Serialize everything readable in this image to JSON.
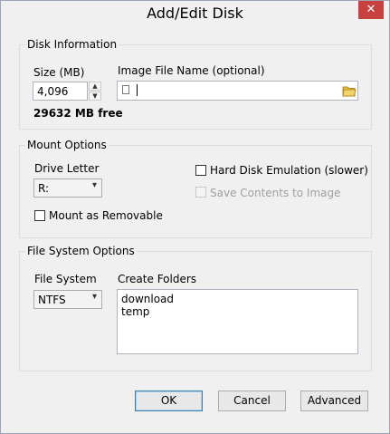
{
  "window": {
    "title": "Add/Edit Disk",
    "close_symbol": "✕"
  },
  "disk_info": {
    "group_label": "Disk Information",
    "size_label": "Size (MB)",
    "size_value": "4,096",
    "free_text": "29632 MB free",
    "image_label": "Image File Name (optional)",
    "image_value": ""
  },
  "mount": {
    "group_label": "Mount Options",
    "drive_letter_label": "Drive Letter",
    "drive_letter_value": "R:",
    "hard_disk_emulation": {
      "label": "Hard Disk Emulation (slower)",
      "checked": false
    },
    "save_contents": {
      "label": "Save Contents to Image",
      "checked": false,
      "enabled": false
    },
    "mount_removable": {
      "label": "Mount as Removable",
      "checked": false
    }
  },
  "fs": {
    "group_label": "File System Options",
    "fs_label": "File System",
    "fs_value": "NTFS",
    "folders_label": "Create Folders",
    "folders": [
      "download",
      "temp"
    ]
  },
  "buttons": {
    "ok": "OK",
    "cancel": "Cancel",
    "advanced": "Advanced"
  },
  "colors": {
    "close_bg": "#c7413e",
    "default_border": "#3c7fb1",
    "folder": "#e8c04a"
  }
}
